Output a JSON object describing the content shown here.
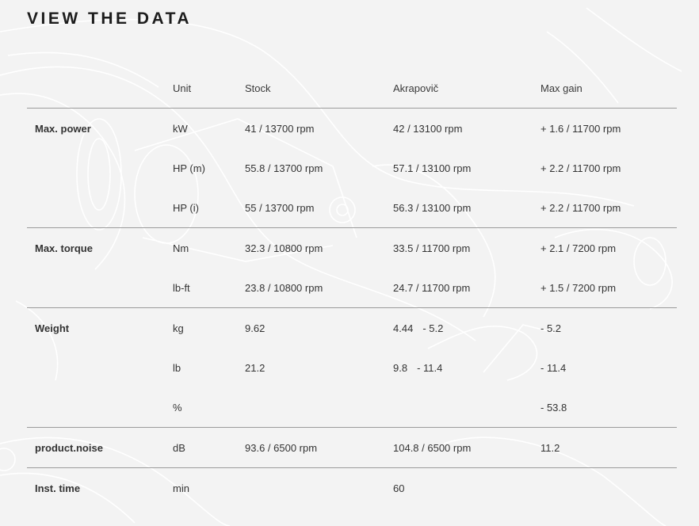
{
  "page": {
    "title": "VIEW THE DATA"
  },
  "table": {
    "headers": [
      "",
      "Unit",
      "Stock",
      "Akrapovič",
      "Max gain"
    ],
    "rows": [
      {
        "label": "Max. power",
        "unit": "kW",
        "stock": "41 / 13700 rpm",
        "akrapovic": "42 / 13100 rpm",
        "gain": "+ 1.6 / 11700 rpm"
      },
      {
        "label": "",
        "unit": "HP (m)",
        "stock": "55.8 / 13700 rpm",
        "akrapovic": "57.1 / 13100 rpm",
        "gain": "+ 2.2 / 11700 rpm"
      },
      {
        "label": "",
        "unit": "HP (i)",
        "stock": "55 / 13700 rpm",
        "akrapovic": "56.3 / 13100 rpm",
        "gain": "+ 2.2 / 11700 rpm"
      },
      {
        "label": "Max. torque",
        "unit": "Nm",
        "stock": "32.3 / 10800 rpm",
        "akrapovic": "33.5 / 11700 rpm",
        "gain": "+ 2.1 / 7200 rpm"
      },
      {
        "label": "",
        "unit": "lb-ft",
        "stock": "23.8 / 10800 rpm",
        "akrapovic": "24.7 / 11700 rpm",
        "gain": "+ 1.5 / 7200 rpm"
      },
      {
        "label": "Weight",
        "unit": "kg",
        "stock": "9.62",
        "akrapovic": "4.44",
        "akrapovic_note": "- 5.2",
        "gain": "- 5.2"
      },
      {
        "label": "",
        "unit": "lb",
        "stock": "21.2",
        "akrapovic": "9.8",
        "akrapovic_note": "- 11.4",
        "gain": "- 11.4"
      },
      {
        "label": "",
        "unit": "%",
        "stock": "",
        "akrapovic": "",
        "gain": "- 53.8"
      },
      {
        "label": "product.noise",
        "unit": "dB",
        "stock": "93.6 / 6500 rpm",
        "akrapovic": "104.8 / 6500 rpm",
        "gain": "11.2"
      },
      {
        "label": "Inst. time",
        "unit": "min",
        "stock": "",
        "akrapovic": "60",
        "gain": ""
      }
    ]
  },
  "background": {
    "icon": "motorcycle-line-art"
  }
}
